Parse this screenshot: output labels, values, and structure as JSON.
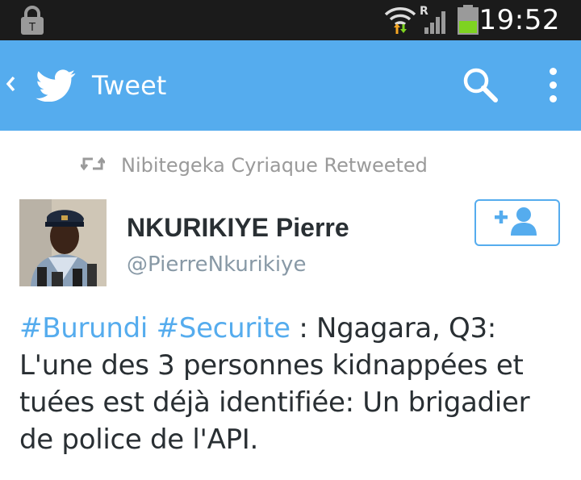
{
  "status_bar": {
    "time": "19:52",
    "roaming_indicator": "R",
    "icons": [
      "lock-icon",
      "wifi-icon",
      "signal-icon",
      "battery-icon"
    ]
  },
  "action_bar": {
    "title": "Tweet",
    "icons": [
      "back-icon",
      "twitter-bird-icon",
      "search-icon",
      "overflow-menu-icon"
    ]
  },
  "retweet_context": {
    "text": "Nibitegeka Cyriaque Retweeted",
    "icon": "retweet-icon"
  },
  "tweet": {
    "author_name": "NKURIKIYE Pierre",
    "author_handle": "@PierreNkurikiye",
    "hashtag_1": "#Burundi",
    "hashtag_2": "#Securite",
    "body": " : Ngagara, Q3: L'une des 3 personnes kidnappées et tuées est déjà identifiée: Un brigadier de police de l'API.",
    "follow_icon": "add-user-icon"
  },
  "colors": {
    "status_bar_bg": "#1b1b1b",
    "action_bar_bg": "#55acee",
    "hashtag": "#55acee",
    "text": "#292f33",
    "secondary_text": "#8899a6",
    "battery_fill": "#7ed321"
  }
}
